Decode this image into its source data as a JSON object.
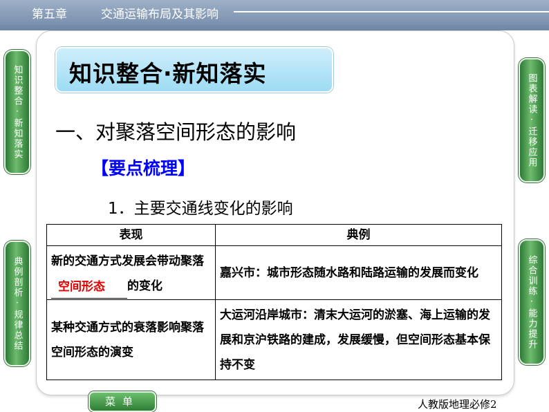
{
  "header": {
    "chapter": "第五章",
    "title": "交通运输布局及其影响"
  },
  "heading_box": "知识整合·新知落实",
  "section_title": "一、对聚落空间形态的影响",
  "subsection_title": "【要点梳理】",
  "point_title": "1．主要交通线变化的影响",
  "table": {
    "headers": [
      "表现",
      "典例"
    ],
    "rows": [
      {
        "left_prefix": "新的交通方式发展会带动聚落",
        "left_blank": "空间形态",
        "left_suffix": "的变化",
        "right": "嘉兴市：城市形态随水路和陆路运输的发展而变化"
      },
      {
        "left": "某种交通方式的衰落影响聚落空间形态的演变",
        "right": "大运河沿岸城市：清末大运河的淤塞、海上运输的发展和京沪铁路的建成，发展缓慢，但空间形态基本保持不变"
      }
    ]
  },
  "sidebar_left": [
    {
      "label": "知识整合·新知落实"
    },
    {
      "label": "典例剖析·规律总结"
    }
  ],
  "sidebar_right": [
    {
      "label": "图表解读·迁移应用"
    },
    {
      "label": "综合训练·能力提升"
    }
  ],
  "menu_label": "菜单",
  "footer": "人教版地理必修2"
}
